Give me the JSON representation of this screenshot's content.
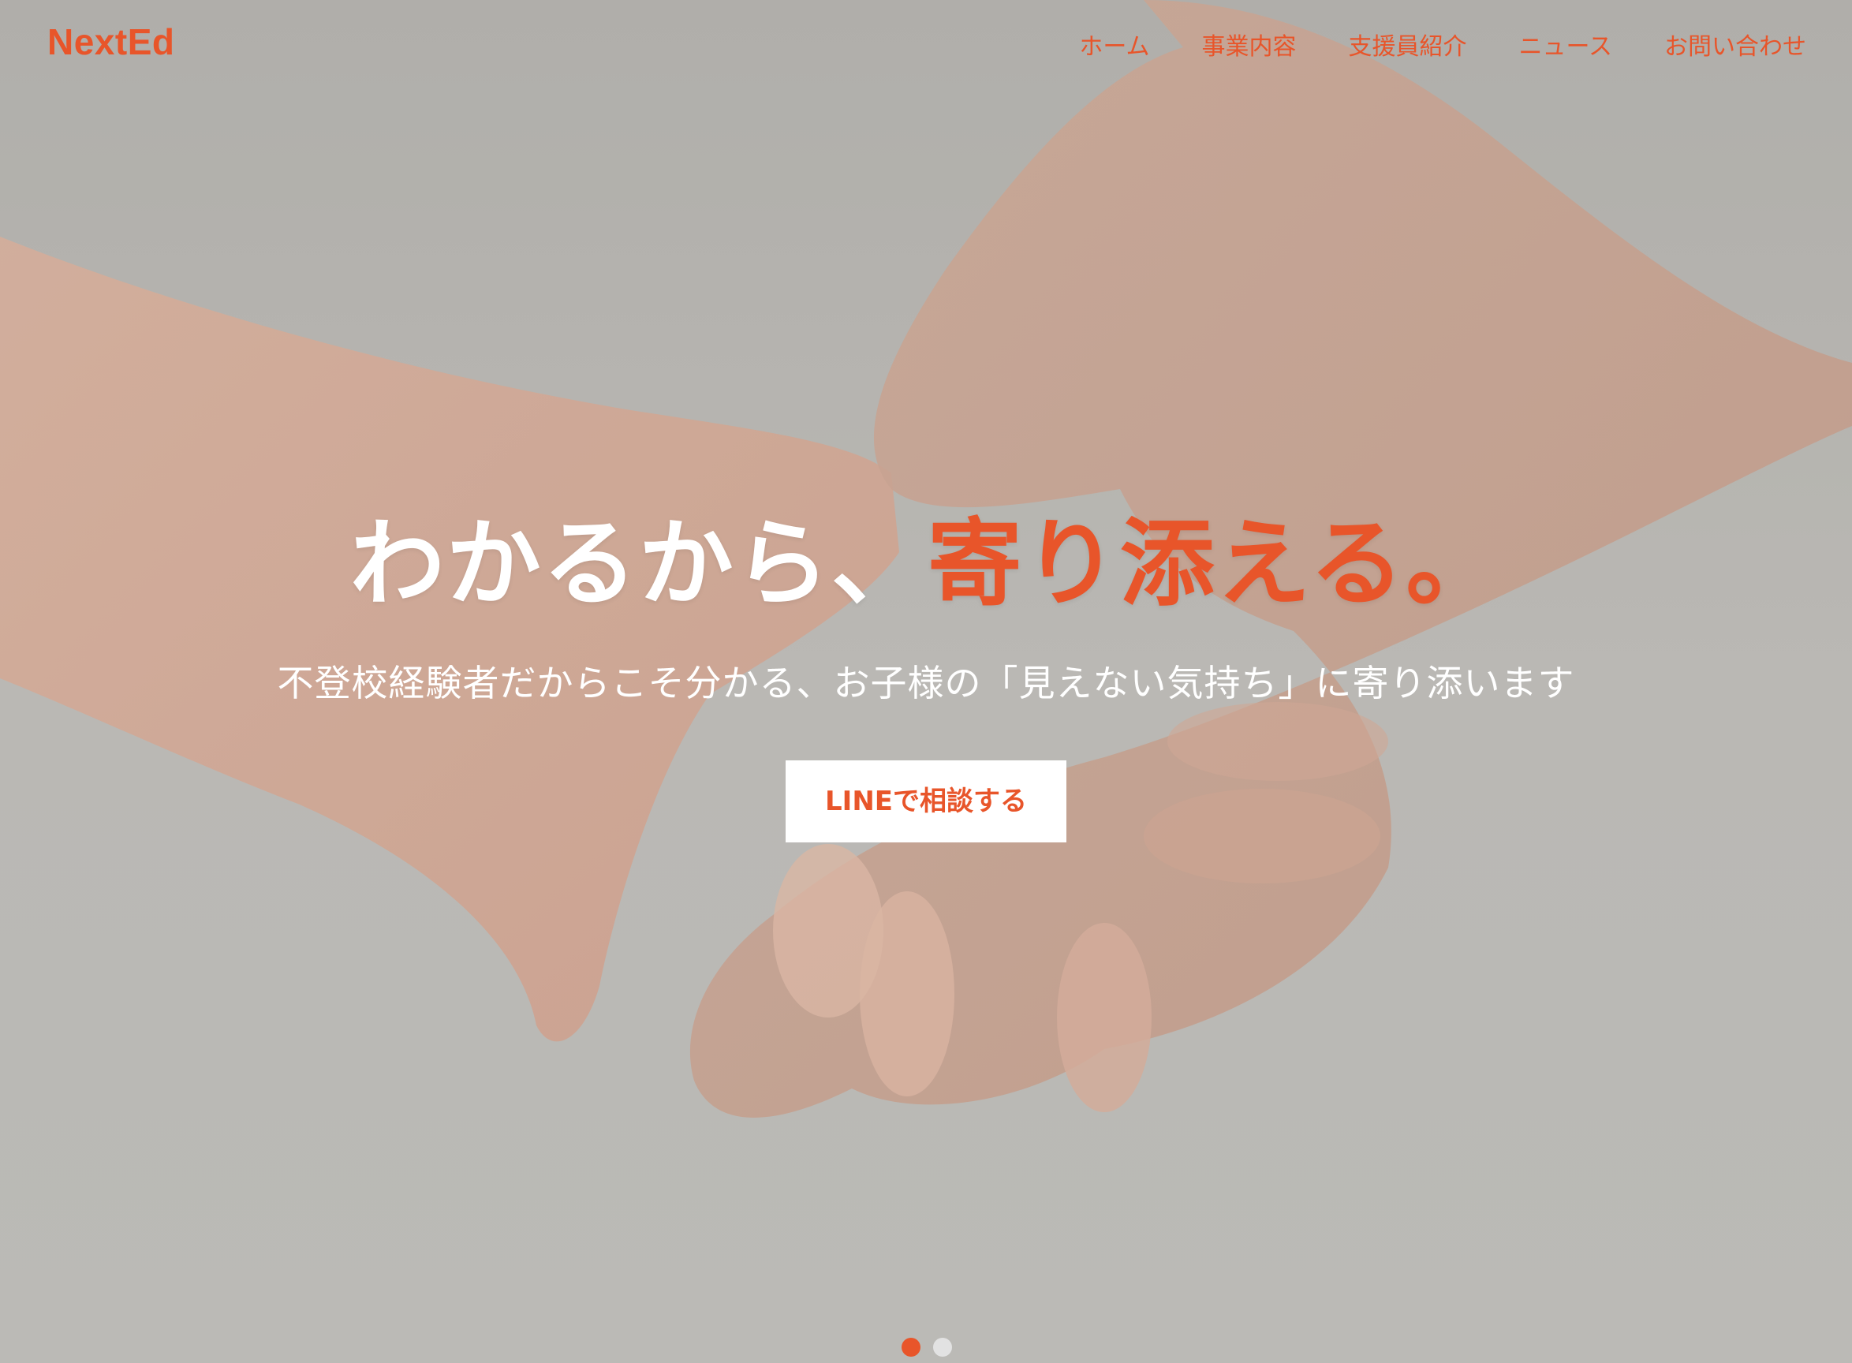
{
  "brand": {
    "logo_text": "NextEd",
    "accent_color": "#e8552a"
  },
  "nav": {
    "items": [
      {
        "label": "ホーム"
      },
      {
        "label": "事業内容"
      },
      {
        "label": "支援員紹介"
      },
      {
        "label": "ニュース"
      },
      {
        "label": "お問い合わせ"
      }
    ]
  },
  "hero": {
    "headline_white": "わかるから、",
    "headline_accent": "寄り添える。",
    "subtitle": "不登校経験者だからこそ分かる、お子様の「見えない気持ち」に寄り添います",
    "cta_label": "LINEで相談する",
    "headline_color": "#ffffff",
    "background_image": "holding-hands-photo"
  },
  "carousel": {
    "slide_count": 2,
    "active_index": 0,
    "active_color": "#e8552a",
    "inactive_color": "#e2e2e2"
  }
}
